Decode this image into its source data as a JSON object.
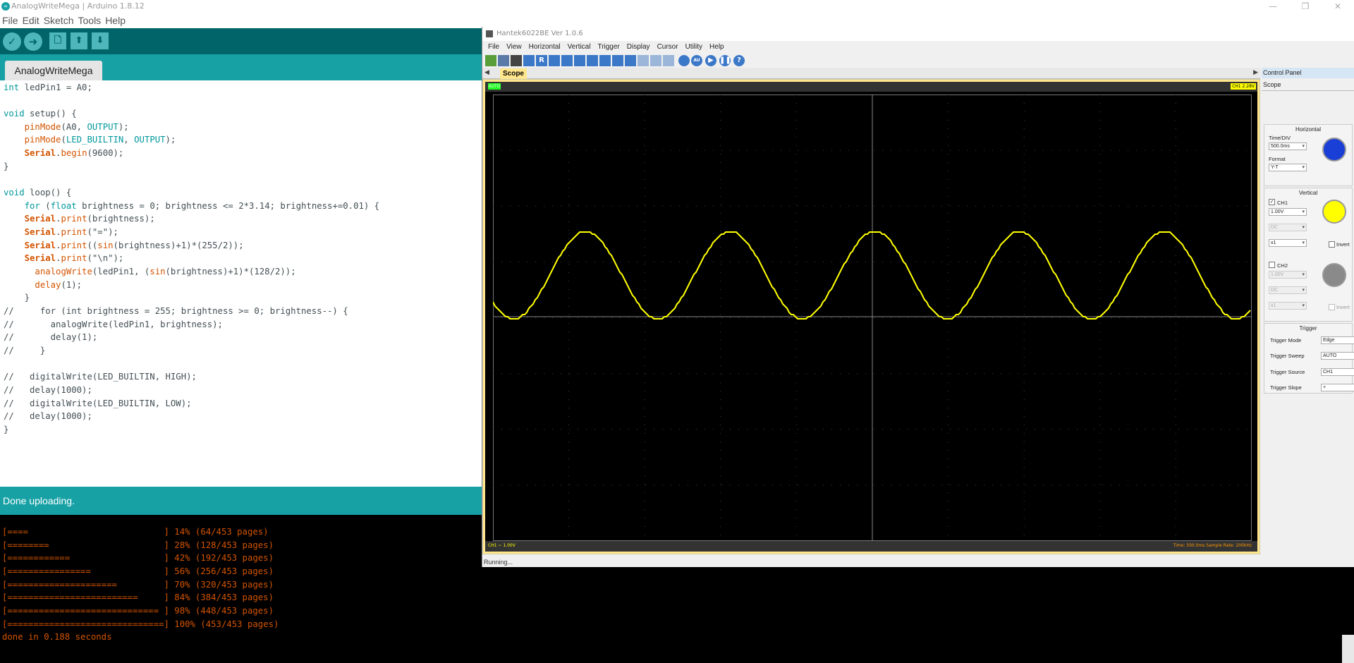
{
  "arduino": {
    "title": "AnalogWriteMega | Arduino 1.8.12",
    "window_controls": [
      "—",
      "❐",
      "✕"
    ],
    "menu": [
      "File",
      "Edit",
      "Sketch",
      "Tools",
      "Help"
    ],
    "toolbar": {
      "verify": "✓",
      "upload": "➜",
      "new": "🗋",
      "open": "⬆",
      "save": "⬇"
    },
    "tab_label": "AnalogWriteMega",
    "status": "Done uploading.",
    "console_lines": [
      "[====                          ] 14% (64/453 pages)",
      "[========                      ] 28% (128/453 pages)",
      "[============                  ] 42% (192/453 pages)",
      "[================              ] 56% (256/453 pages)",
      "[=====================         ] 70% (320/453 pages)",
      "[=========================     ] 84% (384/453 pages)",
      "[============================= ] 98% (448/453 pages)",
      "[==============================] 100% (453/453 pages)",
      "done in 0.188 seconds"
    ],
    "code": {
      "l1a": "int",
      "l1b": " ledPin1 = A0;",
      "l3a": "void",
      "l3b": " setup() {",
      "l4a": "    ",
      "l4b": "pinMode",
      "l4c": "(A0, ",
      "l4d": "OUTPUT",
      "l4e": ");",
      "l5a": "    ",
      "l5b": "pinMode",
      "l5c": "(",
      "l5d": "LED_BUILTIN",
      "l5e": ", ",
      "l5f": "OUTPUT",
      "l5g": ");",
      "l6a": "    ",
      "l6b": "Serial",
      "l6c": ".",
      "l6d": "begin",
      "l6e": "(9600);",
      "l7": "}",
      "l9a": "void",
      "l9b": " loop() {",
      "l10a": "    ",
      "l10b": "for",
      "l10c": " (",
      "l10d": "float",
      "l10e": " brightness = 0; brightness <= 2*3.14; brightness+=0.01) {",
      "l11a": "    ",
      "l11b": "Serial",
      "l11c": ".",
      "l11d": "print",
      "l11e": "(brightness);",
      "l12a": "    ",
      "l12b": "Serial",
      "l12c": ".",
      "l12d": "print",
      "l12e": "(\"=\");",
      "l13a": "    ",
      "l13b": "Serial",
      "l13c": ".",
      "l13d": "print",
      "l13e": "((",
      "l13f": "sin",
      "l13g": "(brightness)+1)*(255/2));",
      "l14a": "    ",
      "l14b": "Serial",
      "l14c": ".",
      "l14d": "print",
      "l14e": "(\"\\n\");",
      "l15a": "      ",
      "l15b": "analogWrite",
      "l15c": "(ledPin1, (",
      "l15d": "sin",
      "l15e": "(brightness)+1)*(128/2));",
      "l16a": "      ",
      "l16b": "delay",
      "l16c": "(1);",
      "l17": "    }",
      "l18": "//     for (int brightness = 255; brightness >= 0; brightness--) {",
      "l19": "//       analogWrite(ledPin1, brightness);",
      "l20": "//       delay(1);",
      "l21": "//     }",
      "l23": "//   digitalWrite(LED_BUILTIN, HIGH);",
      "l24": "//   delay(1000);",
      "l25": "//   digitalWrite(LED_BUILTIN, LOW);",
      "l26": "//   delay(1000);",
      "l27": "}"
    }
  },
  "hantek": {
    "title": "Hantek6022BE Ver 1.0.6",
    "menu": [
      "File",
      "View",
      "Horizontal",
      "Vertical",
      "Trigger",
      "Display",
      "Cursor",
      "Utility",
      "Help"
    ],
    "tab": "Scope",
    "auto_badge": "AUTO",
    "trigger_badge": "CH1  2.28V",
    "ch1_scale": "CH1 ~  1.00V",
    "time_info": "Time: 500.0ms     Sample Rate: 200kHz",
    "status": "Running...",
    "control_panel": {
      "title": "Control Panel",
      "scope": "Scope",
      "horizontal": {
        "title": "Horizontal",
        "time_div_label": "Time/DIV",
        "time_div_value": "500.0ms",
        "format_label": "Format",
        "format_value": "Y-T"
      },
      "vertical": {
        "title": "Vertical",
        "ch1_label": "CH1",
        "ch1_volts": "1.00V",
        "ch1_coupling": "DC",
        "ch1_probe": "x1",
        "ch1_invert": "Invert",
        "ch2_label": "CH2",
        "ch2_volts": "1.00V",
        "ch2_coupling": "DC",
        "ch2_probe": "x1",
        "ch2_invert": "Invert"
      },
      "trigger": {
        "title": "Trigger",
        "mode_label": "Trigger Mode",
        "mode_value": "Edge",
        "sweep_label": "Trigger Sweep",
        "sweep_value": "AUTO",
        "source_label": "Trigger Source",
        "source_value": "CH1",
        "slope_label": "Trigger Slope",
        "slope_value": "+"
      }
    },
    "colors": {
      "ch1": "#ffff00",
      "horizontal_knob": "#1a3fd6",
      "ch1_knob": "#ffff00",
      "ch2_knob": "#8a8a8a"
    }
  }
}
